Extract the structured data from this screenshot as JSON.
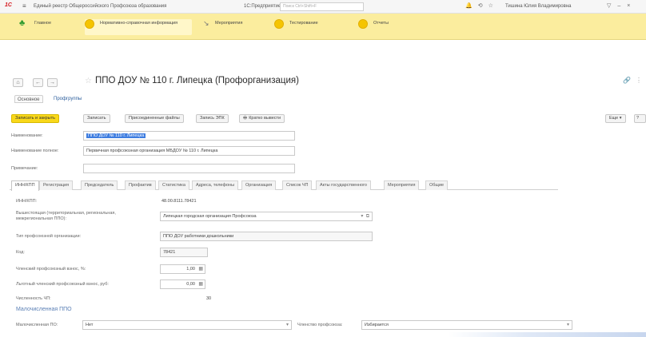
{
  "window": {
    "logo": "1С",
    "title": "Единый реестр Общероссийского Профсоюза образования",
    "subtitle": "1С:Предприятие",
    "search_placeholder": "Поиск Ctrl+Shift+F",
    "user": "Тишина Юлия Владимировна"
  },
  "sections": [
    {
      "label": "Главное"
    },
    {
      "label": "Нормативно-справочная информация"
    },
    {
      "label": "Мероприятия"
    },
    {
      "label": "Тестирование"
    },
    {
      "label": "Отчеты"
    }
  ],
  "form": {
    "title": "ППО ДОУ № 110 г. Липецка (Профорганизация)",
    "tabs": [
      "Основное",
      "Профгруппы"
    ]
  },
  "commands": {
    "save_close": "Записать и закрыть",
    "save": "Записать",
    "attached_files": "Присоединенные файлы",
    "epo_record": "Запись ЭПК",
    "print": "Кратко вывести",
    "more": "Еще"
  },
  "fields": {
    "name_label": "Наименование:",
    "name_value": "ППО ДОУ № 110 г. Липецка",
    "full_name_label": "Наименование полное:",
    "full_name_value": "Первичная профсоюзная организация МБДОУ № 110 г. Липецка",
    "note_label": "Примечание:",
    "note_value": ""
  },
  "tabs": [
    "ИНН/КПП",
    "Регистрация",
    "Председатель",
    "Профактив",
    "Статистика",
    "Адреса, телефоны",
    "Организация",
    "Список ЧП",
    "Акты государственного",
    "Мероприятия",
    "Общие"
  ],
  "details": {
    "inn_label": "ИНН/КПП:",
    "inn_value": "48.00.8111.78421",
    "parent_label": "Вышестоящая (территориальная, региональная, межрегиональная ППО):",
    "parent_value": "Липецкая городская организация Профсоюза",
    "type_label": "Тип профсоюзной организации:",
    "type_value": "ППО ДОУ работники дошкольники",
    "code_label": "Код:",
    "code_value": "78421",
    "rate_label": "Членский профсоюзный взнос, %:",
    "rate_value": "1,00",
    "fixed_label": "Льготный членский профсоюзный взнос, руб:",
    "fixed_value": "0,00",
    "members_label": "Численность ЧП:",
    "members_value": "30"
  },
  "small_group": {
    "title": "Малочисленная ППО",
    "small_label": "Малочисленная ПО:",
    "small_value": "Нет",
    "member_label": "Членство профсоюза:",
    "member_value": "Избирается"
  }
}
